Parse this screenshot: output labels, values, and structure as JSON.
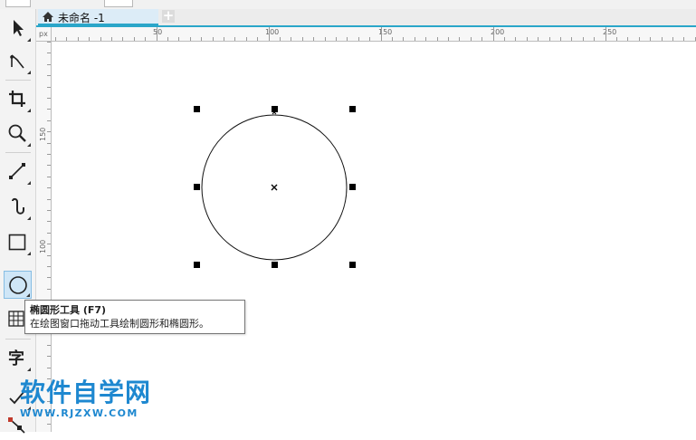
{
  "document_tab": {
    "title": "未命名 -1",
    "add_label": "+"
  },
  "ruler": {
    "horizontal_labels": [
      "50",
      "100",
      "150",
      "200",
      "250"
    ],
    "vertical_labels": [
      "150",
      "100"
    ],
    "corner_label": "px"
  },
  "tooltip": {
    "title": "椭圆形工具 (F7)",
    "description": "在绘图窗口拖动工具绘制圆形和椭圆形。"
  },
  "watermark": {
    "text": "软件自学网",
    "url": "WWW.RJZXW.COM"
  },
  "toolbox": {
    "tools": [
      "pick-tool-icon",
      "shape-tool-icon",
      "crop-tool-icon",
      "zoom-tool-icon",
      "line-tool-icon",
      "artistic-media-icon",
      "rectangle-tool-icon",
      "ellipse-tool-icon",
      "table-tool-icon",
      "text-tool-icon",
      "dimension-tool-icon",
      "connector-tool-icon"
    ],
    "selected": "ellipse-tool-icon"
  },
  "colors": {
    "accent": "#2aa6c9",
    "selected_tool": "#cfe6f7",
    "watermark": "#1e88d0"
  }
}
